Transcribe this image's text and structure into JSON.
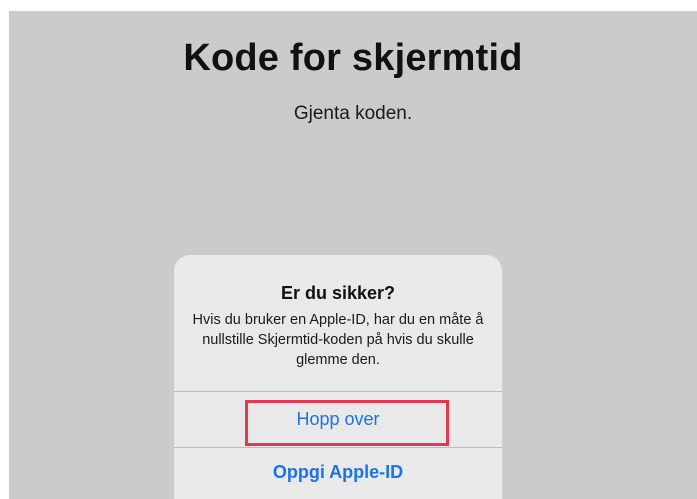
{
  "screen": {
    "title": "Kode for skjermtid",
    "subtitle": "Gjenta koden."
  },
  "alert": {
    "title": "Er du sikker?",
    "message": "Hvis du bruker en Apple-ID, har du en måte å nullstille Skjermtid-koden på hvis du skulle glemme den.",
    "actions": {
      "skip": "Hopp over",
      "apple_id": "Oppgi Apple-ID"
    }
  },
  "colors": {
    "screen_background": "#cbcbcb",
    "alert_background": "#e9e9e9",
    "action_text": "#1a73e8",
    "highlight": "#e6374f"
  }
}
